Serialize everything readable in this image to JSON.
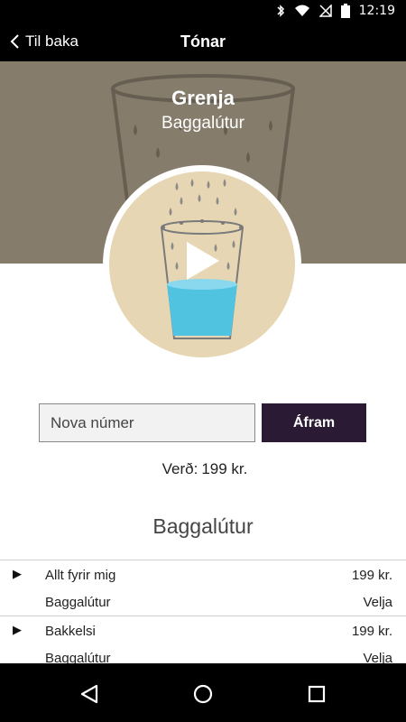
{
  "status_bar": {
    "time": "12:19"
  },
  "app_bar": {
    "back_label": "Til baka",
    "title": "Tónar"
  },
  "hero": {
    "song_title": "Grenja",
    "artist": "Baggalútur"
  },
  "purchase": {
    "number_placeholder": "Nova númer",
    "continue_label": "Áfram",
    "price_label": "Verð:",
    "price_value": "199 kr."
  },
  "section": {
    "title": "Baggalútur"
  },
  "songs": [
    {
      "name": "Allt fyrir mig",
      "price": "199 kr.",
      "artist": "Baggalútur",
      "select_label": "Velja"
    },
    {
      "name": "Bakkelsi",
      "price": "199 kr.",
      "artist": "Baggalútur",
      "select_label": "Velja"
    }
  ],
  "colors": {
    "accent_button": "#2a1a33",
    "hero_background": "#857c6b",
    "art_background": "#e6d6b3",
    "water": "#4fc3e0"
  },
  "icons": [
    "bluetooth-icon",
    "wifi-icon",
    "signal-icon",
    "battery-icon",
    "back-chevron-icon",
    "play-icon",
    "nav-back-icon",
    "nav-home-icon",
    "nav-recents-icon"
  ]
}
